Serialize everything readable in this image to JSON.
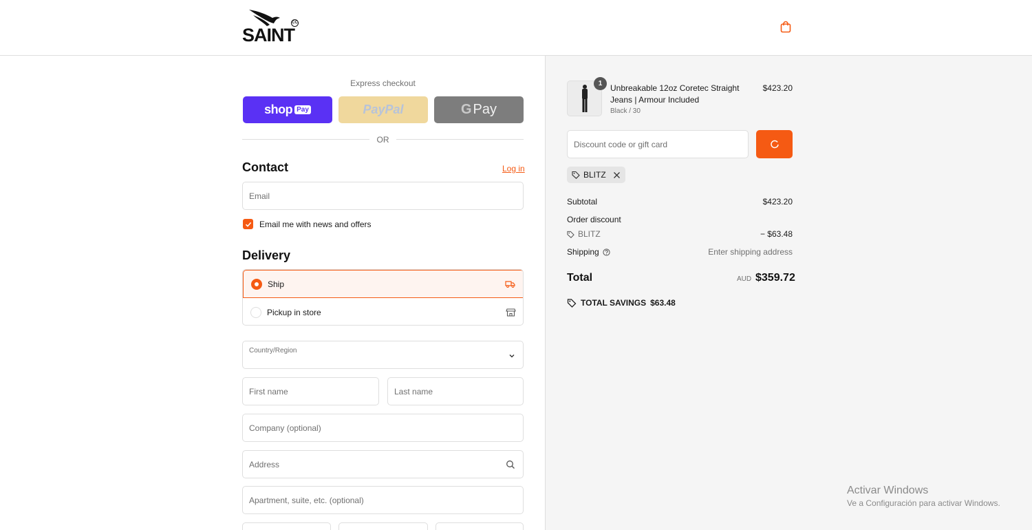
{
  "header": {
    "logo_text": "SAINT",
    "logo_badge": "CC"
  },
  "express": {
    "label": "Express checkout",
    "shop_pay": {
      "brand": "shop",
      "badge": "Pay"
    },
    "paypal": "PayPal",
    "gpay": {
      "g": "G",
      "pay": "Pay"
    },
    "or": "OR"
  },
  "contact": {
    "title": "Contact",
    "login_link": "Log in",
    "email_placeholder": "Email",
    "newsletter_label": "Email me with news and offers",
    "newsletter_checked": true
  },
  "delivery": {
    "title": "Delivery",
    "options": [
      {
        "label": "Ship",
        "selected": true,
        "icon": "truck-icon"
      },
      {
        "label": "Pickup in store",
        "selected": false,
        "icon": "store-icon"
      }
    ],
    "country_label": "Country/Region",
    "first_name_placeholder": "First name",
    "last_name_placeholder": "Last name",
    "company_placeholder": "Company (optional)",
    "address_placeholder": "Address",
    "apartment_placeholder": "Apartment, suite, etc. (optional)"
  },
  "summary": {
    "product": {
      "quantity": "1",
      "title": "Unbreakable 12oz Coretec Straight Jeans | Armour Included",
      "variant": "Black / 30",
      "price": "$423.20"
    },
    "discount_placeholder": "Discount code or gift card",
    "applied_code": "BLITZ",
    "subtotal_label": "Subtotal",
    "subtotal_value": "$423.20",
    "order_discount_label": "Order discount",
    "discount_code": "BLITZ",
    "discount_value": "− $63.48",
    "shipping_label": "Shipping",
    "shipping_value": "Enter shipping address",
    "total_label": "Total",
    "currency": "AUD",
    "total_value": "$359.72",
    "savings_label": "TOTAL SAVINGS",
    "savings_value": "$63.48"
  },
  "watermark": {
    "line1": "Activar Windows",
    "line2": "Ve a Configuración para activar Windows."
  },
  "colors": {
    "accent": "#f55a13",
    "shop_pay": "#5a31f4",
    "paypal": "#f0d89d",
    "gpay": "#7d7d7d",
    "summary_bg": "#f5f5f5"
  }
}
